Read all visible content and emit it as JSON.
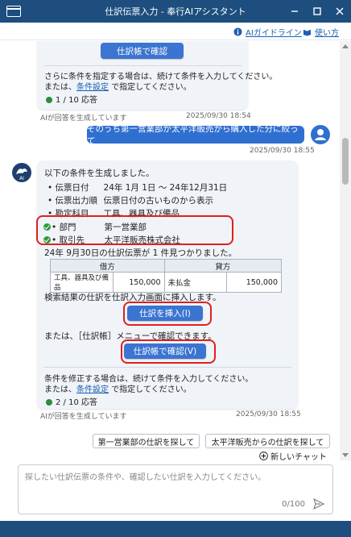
{
  "window": {
    "title": "仕訳伝票入力 - 奉行AIアシスタント"
  },
  "toolbar": {
    "guide_label": "AIガイドライン",
    "howto_label": "使い方"
  },
  "message1": {
    "button_label": "仕訳帳で確認",
    "hint_line1": "さらに条件を指定する場合は、続けて条件を入力してください。",
    "hint_line2_prefix": "または、",
    "hint_link": "条件設定",
    "hint_line2_suffix": " で指定してください。",
    "count": "1 / 10 応答",
    "disclaimer": "AIが回答を生成しています",
    "timestamp": "2025/09/30 18:54"
  },
  "user_message": {
    "text": "そのうち第一営業部が太平洋販売から購入した分に絞って",
    "timestamp": "2025/09/30 18:55"
  },
  "message2": {
    "intro": "以下の条件を生成しました。",
    "conditions": [
      {
        "label": "伝票日付",
        "value": "24年  1月  1日  〜  24年12月31日"
      },
      {
        "label": "伝票出力順",
        "value": "伝票日付の古いものから表示"
      },
      {
        "label": "勘定科目",
        "value": "工具、器具及び備品"
      }
    ],
    "new_conditions": [
      {
        "label": "部門",
        "value": "第一営業部"
      },
      {
        "label": "取引先",
        "value": "太平洋販売株式会社"
      }
    ],
    "result": "24年  9月30日の仕訳伝票が  1 件見つかりました。",
    "journal": {
      "debit_header": "借方",
      "credit_header": "貸方",
      "debit_account": "工具、器具及び備品",
      "debit_amount": "150,000",
      "credit_account": "未払金",
      "credit_amount": "150,000"
    },
    "insert_text": "検索結果の仕訳を仕訳入力画面に挿入します。",
    "insert_button": "仕訳を挿入(I)",
    "or_text": "または、［仕訳帳］メニューで確認できます。",
    "confirm_button": "仕訳帳で確認(V)",
    "hint_line1": "条件を修正する場合は、続けて条件を入力してください。",
    "hint_line2_prefix": "または、",
    "hint_link": "条件設定",
    "hint_line2_suffix": " で指定してください。",
    "count": "2 / 10 応答",
    "disclaimer": "AIが回答を生成しています",
    "timestamp": "2025/09/30 18:55"
  },
  "suggestions": [
    "第一営業部の仕訳を探して",
    "太平洋販売からの仕訳を探して"
  ],
  "new_chat_label": "新しいチャット",
  "input": {
    "placeholder": "探したい仕訳伝票の条件や、確認したい仕訳を入力してください。",
    "counter": "0/100"
  },
  "colors": {
    "titlebar": "#1d4e7e",
    "accent": "#3b74d1",
    "highlight": "#e0201e",
    "status_dot": "#2e8b3a"
  }
}
